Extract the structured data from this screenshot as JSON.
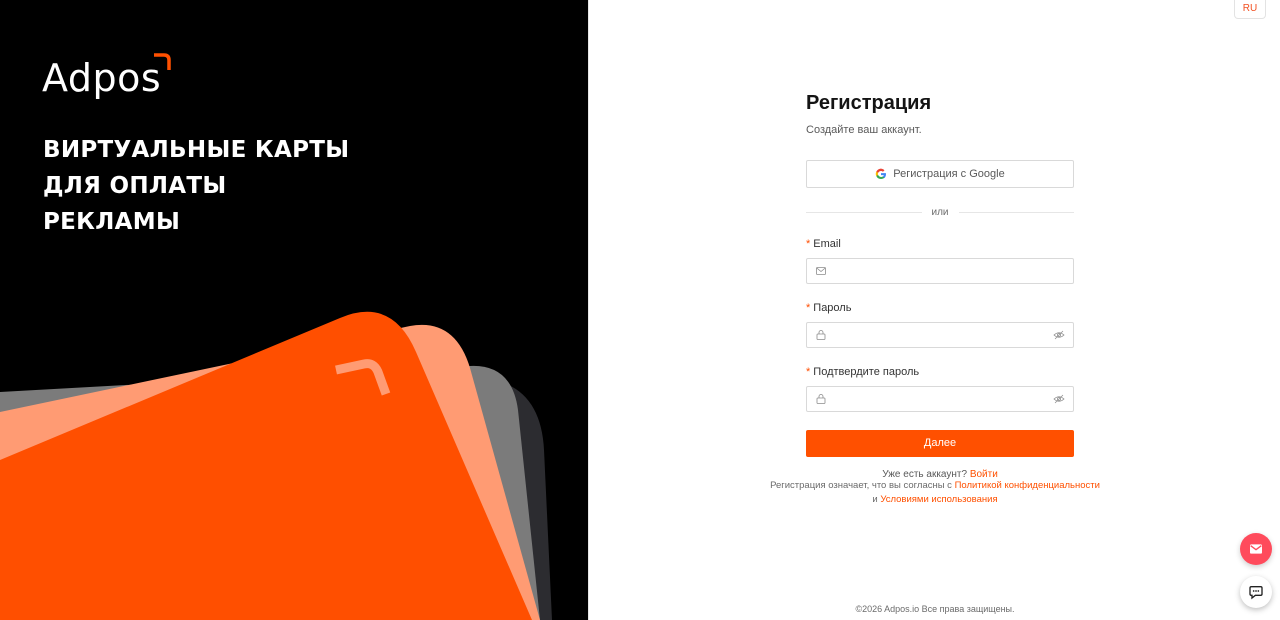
{
  "brand": {
    "name": "Adpos",
    "accent_color": "#ff5000"
  },
  "promo": {
    "lines": [
      "ВИРТУАЛЬНЫЕ КАРТЫ",
      "ДЛЯ ОПЛАТЫ",
      "РЕКЛАМЫ"
    ]
  },
  "lang": {
    "label": "RU"
  },
  "form": {
    "title": "Регистрация",
    "subtitle": "Создайте ваш аккаунт.",
    "google_label": "Регистрация с Google",
    "divider_text": "или",
    "required_mark": "*",
    "email_label": "Email",
    "email_value": "",
    "password_label": "Пароль",
    "password_value": "",
    "confirm_label": "Подтвердите пароль",
    "confirm_value": "",
    "submit_label": "Далее",
    "has_account_text": "Уже есть аккаунт?",
    "login_link": "Войти"
  },
  "terms": {
    "prefix": "Регистрация означает, что вы согласны с",
    "privacy_link": "Политикой конфиденциальности",
    "and_text": "и",
    "usage_link": "Условиями использования"
  },
  "footer": {
    "copyright": "©2026 Adpos.io Все права защищены."
  },
  "icons": {
    "google": "google-icon",
    "mail": "mail-icon",
    "lock": "lock-icon",
    "eye": "eye-icon",
    "support_mail": "mail-icon",
    "chat": "chat-icon"
  }
}
